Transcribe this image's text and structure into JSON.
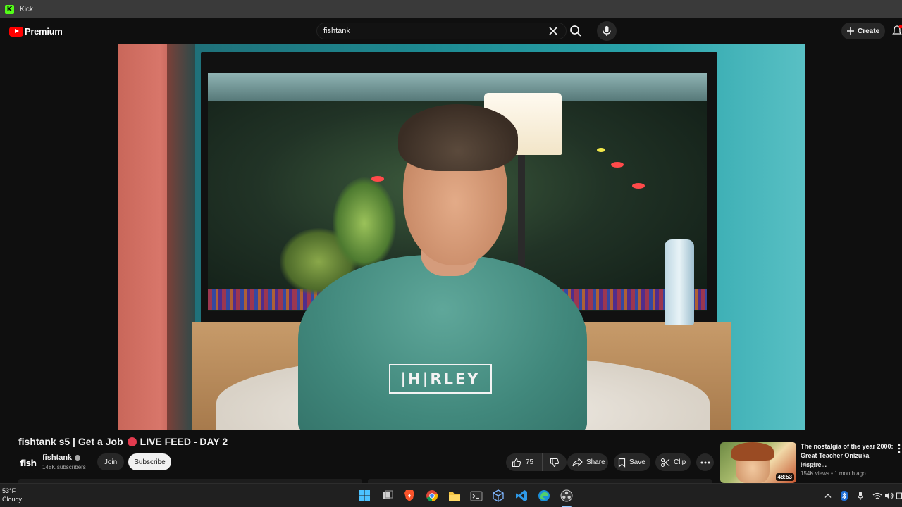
{
  "window": {
    "title": "Kick"
  },
  "header": {
    "brand": "Premium",
    "search_value": "fishtank",
    "create_label": "Create"
  },
  "video": {
    "title": "fishtank s5 | Get a Job",
    "live_text": "LIVE FEED - DAY 2",
    "shirt_text": "|H|RLEY"
  },
  "channel": {
    "avatar_text": "fish",
    "name": "fishtank",
    "subscribers": "148K subscribers",
    "join_label": "Join",
    "subscribe_label": "Subscribe"
  },
  "actions": {
    "like_count": "75",
    "share_label": "Share",
    "save_label": "Save",
    "clip_label": "Clip"
  },
  "recommended": {
    "title": "The nostalgia of the year 2000: Great Teacher Onizuka inspire...",
    "channel": "tetsuya",
    "meta": "154K views • 1 month ago",
    "duration": "48:53"
  },
  "taskbar": {
    "temp": "53°F",
    "weather": "Cloudy"
  },
  "colors": {
    "youtube_red": "#ff0000",
    "live_red": "#e23b4f",
    "kick_green": "#53fc18"
  }
}
